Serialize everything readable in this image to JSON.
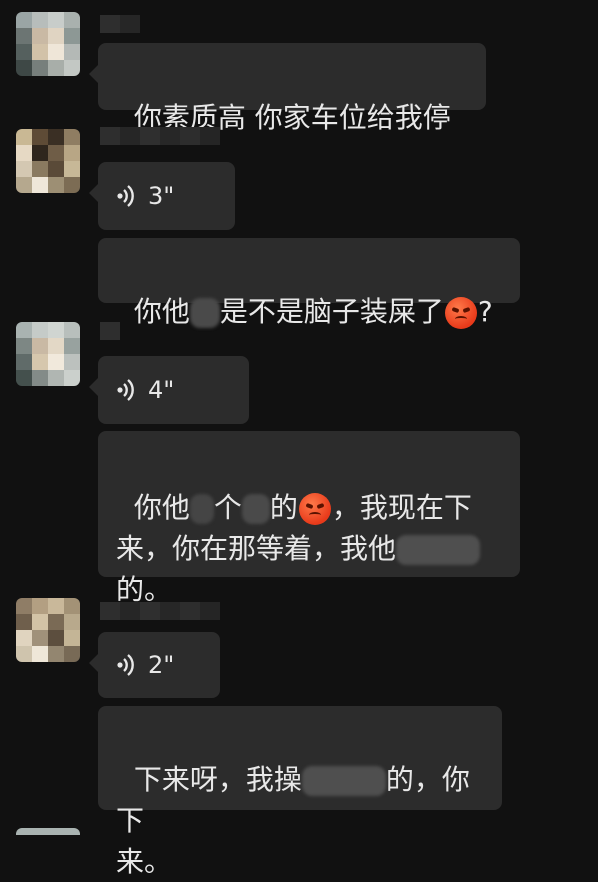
{
  "colors": {
    "background": "#111111",
    "bubble": "#2c2c2c",
    "text": "#e8e8e8"
  },
  "messages": [
    {
      "type": "text",
      "text": "你素质高 你家车位给我停"
    },
    {
      "type": "voice",
      "duration": "3\""
    },
    {
      "type": "text",
      "parts": [
        "你他",
        "是不是脑子装屎了",
        "?"
      ]
    },
    {
      "type": "voice",
      "duration": "4\""
    },
    {
      "type": "text",
      "parts": [
        "你他",
        "个",
        "的",
        "，我现在下",
        "来，你在那等着，我他",
        "的。"
      ]
    },
    {
      "type": "voice",
      "duration": "2\""
    },
    {
      "type": "text",
      "parts": [
        "下来呀，我操",
        "的，你下",
        "来。"
      ]
    }
  ]
}
